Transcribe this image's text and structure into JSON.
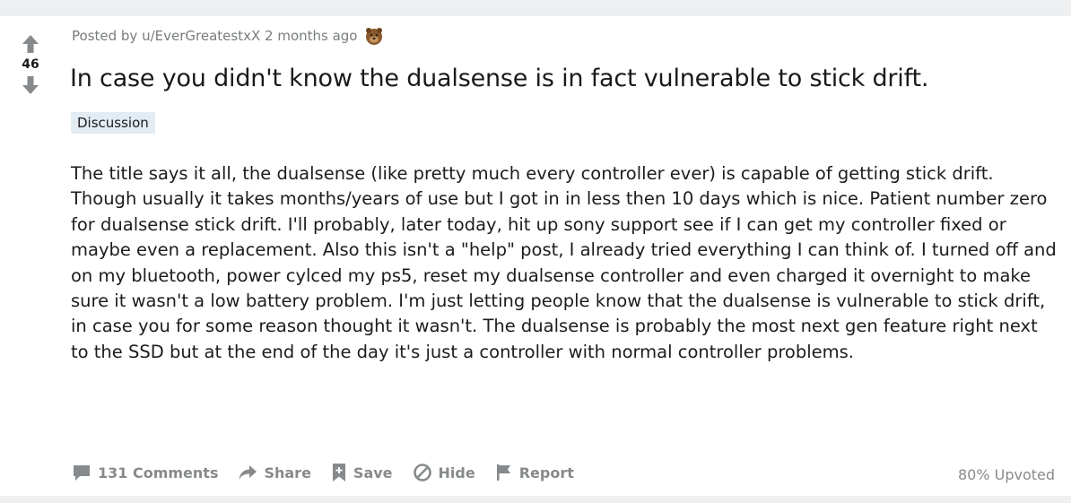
{
  "post": {
    "vote_count": "46",
    "meta_prefix": "Posted by ",
    "author": "u/EverGreatestxX",
    "time": "2 months ago",
    "title": "In case you didn't know the dualsense is in fact vulnerable to stick drift.",
    "flair": "Discussion",
    "body": "The title says it all, the dualsense (like pretty much every controller ever) is capable of getting stick drift. Though usually it takes months/years of use but I got in in less then 10 days which is nice. Patient number zero for dualsense stick drift. I'll probably, later today, hit up sony support see if I can get my controller fixed or maybe even a replacement. Also this isn't a \"help\" post, I already tried everything I can think of. I turned off and on my bluetooth, power cylced my ps5, reset my dualsense controller and even charged it overnight to make sure it wasn't a low battery problem. I'm just letting people know that the dualsense is vulnerable to stick drift, in case you for some reason thought it wasn't. The dualsense is probably the most next gen feature right next to the SSD but at the end of the day it's just a controller with normal controller problems."
  },
  "actions": {
    "comments": "131 Comments",
    "share": "Share",
    "save": "Save",
    "hide": "Hide",
    "report": "Report"
  },
  "upvote_ratio": "80% Upvoted",
  "icons": {
    "upvote": "arrow-up-icon",
    "downvote": "arrow-down-icon",
    "comment": "comment-icon",
    "share": "share-icon",
    "save": "bookmark-icon",
    "hide": "hide-icon",
    "report": "flag-icon"
  },
  "colors": {
    "muted": "#878a8c",
    "flair_bg": "#e3ecf3",
    "frame": "#edeff1"
  }
}
